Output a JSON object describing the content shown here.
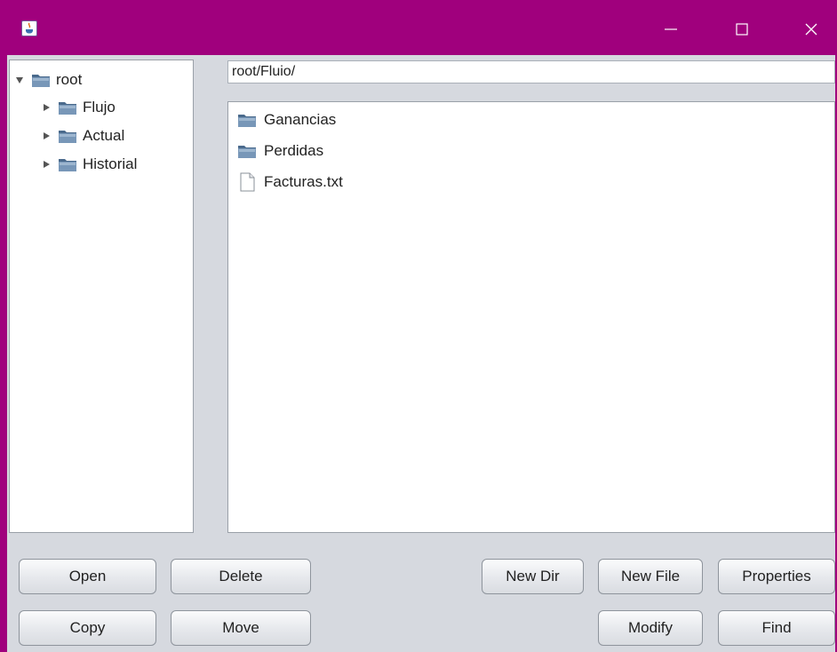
{
  "window": {
    "title": "",
    "controls": {
      "minimize": "—",
      "maximize": "☐",
      "close": "✕"
    },
    "accent_color": "#a0007d"
  },
  "tree": {
    "root": {
      "label": "root",
      "expanded": true,
      "icon": "folder-icon"
    },
    "children": [
      {
        "label": "Flujo",
        "icon": "folder-icon"
      },
      {
        "label": "Actual",
        "icon": "folder-icon"
      },
      {
        "label": "Historial",
        "icon": "folder-icon"
      }
    ]
  },
  "path": {
    "value": "root/Fluio/"
  },
  "files": [
    {
      "name": "Ganancias",
      "icon": "folder-icon"
    },
    {
      "name": "Perdidas",
      "icon": "folder-icon"
    },
    {
      "name": "Facturas.txt",
      "icon": "file-icon"
    }
  ],
  "buttons": {
    "open": "Open",
    "delete": "Delete",
    "new_dir": "New Dir",
    "new_file": "New File",
    "properties": "Properties",
    "copy": "Copy",
    "move": "Move",
    "modify": "Modify",
    "find": "Find"
  }
}
